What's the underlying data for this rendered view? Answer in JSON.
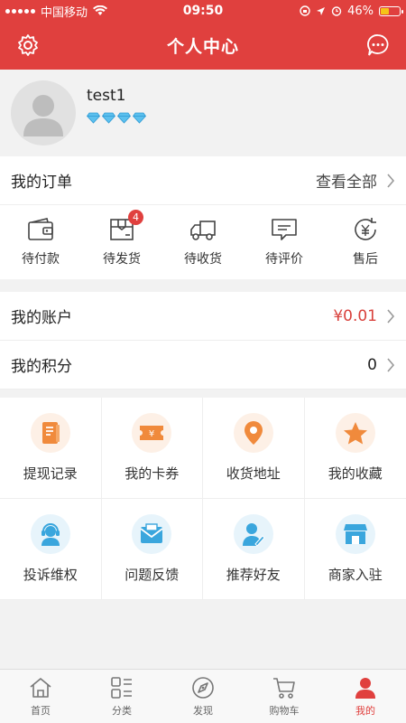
{
  "status_bar": {
    "carrier": "中国移动",
    "time": "09:50",
    "battery": "46%"
  },
  "header": {
    "title": "个人中心"
  },
  "profile": {
    "username": "test1",
    "level_gems": 4
  },
  "orders": {
    "title": "我的订单",
    "view_all": "查看全部",
    "items": [
      {
        "label": "待付款",
        "icon": "wallet-icon"
      },
      {
        "label": "待发货",
        "icon": "package-icon",
        "badge": "4"
      },
      {
        "label": "待收货",
        "icon": "truck-icon"
      },
      {
        "label": "待评价",
        "icon": "comment-icon"
      },
      {
        "label": "售后",
        "icon": "refund-icon"
      }
    ]
  },
  "account": {
    "label": "我的账户",
    "value": "¥0.01",
    "value_color": "#d9413c"
  },
  "points": {
    "label": "我的积分",
    "value": "0"
  },
  "services": [
    {
      "label": "提现记录",
      "icon": "withdraw-record-icon"
    },
    {
      "label": "我的卡券",
      "icon": "coupon-icon"
    },
    {
      "label": "收货地址",
      "icon": "location-pin-icon"
    },
    {
      "label": "我的收藏",
      "icon": "star-icon"
    },
    {
      "label": "投诉维权",
      "icon": "customer-service-icon"
    },
    {
      "label": "问题反馈",
      "icon": "feedback-mail-icon"
    },
    {
      "label": "推荐好友",
      "icon": "recommend-friend-icon"
    },
    {
      "label": "商家入驻",
      "icon": "shop-icon"
    }
  ],
  "tabbar": [
    {
      "label": "首页",
      "icon": "home-icon"
    },
    {
      "label": "分类",
      "icon": "category-icon"
    },
    {
      "label": "发现",
      "icon": "discover-icon"
    },
    {
      "label": "购物车",
      "icon": "cart-icon"
    },
    {
      "label": "我的",
      "icon": "user-icon",
      "active": true
    }
  ],
  "colors": {
    "brand": "#e0403e",
    "orange": "#f08a3c",
    "blue": "#3aa6dd"
  }
}
